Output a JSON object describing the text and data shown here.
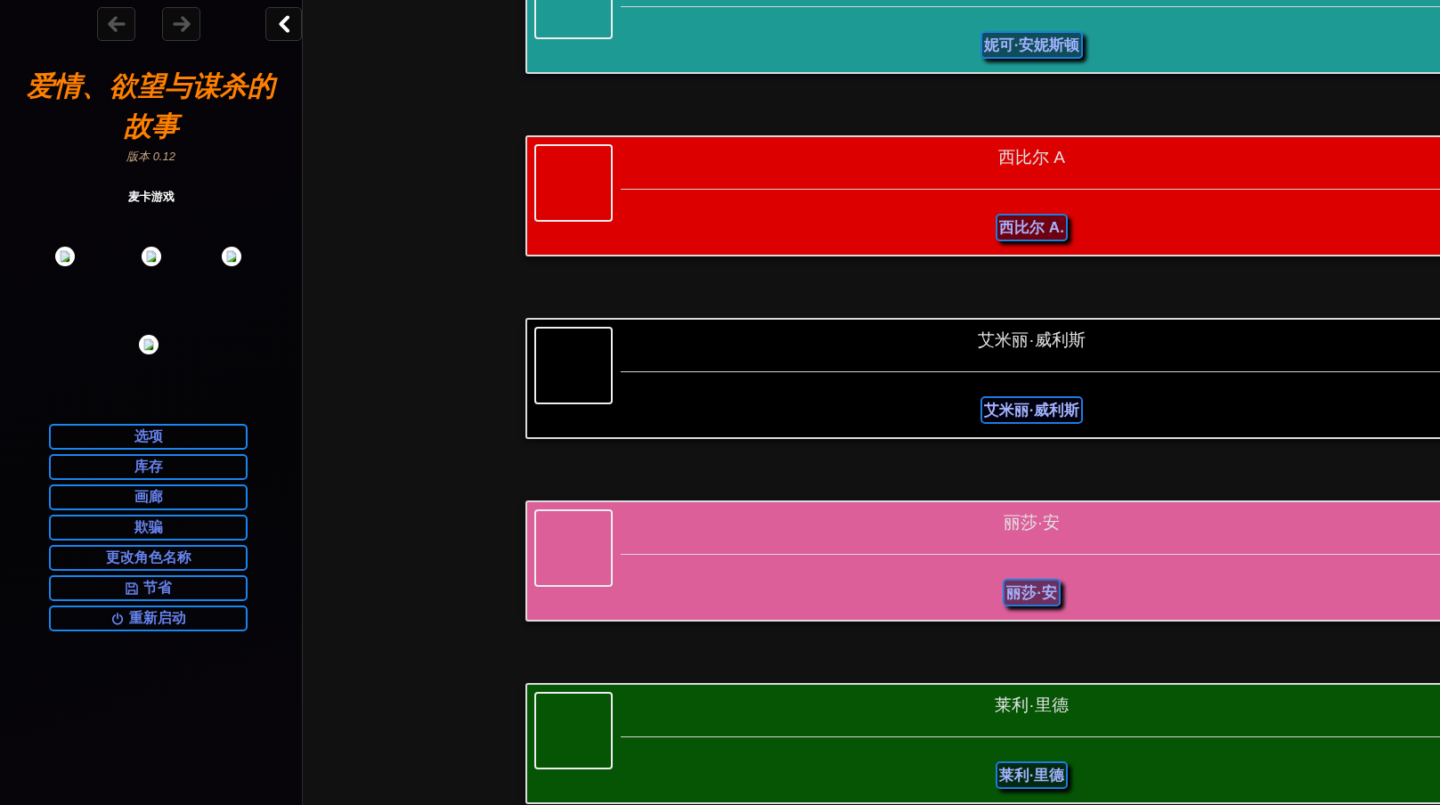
{
  "sidebar": {
    "history_buttons": [
      {
        "kind": "back",
        "disabled": true
      },
      {
        "kind": "forward",
        "disabled": true
      }
    ],
    "title": "爱情、欲望与谋杀的故事",
    "version": "版本 0.12",
    "studio": "麦卡游戏",
    "menu": [
      {
        "label": "选项",
        "kind": "plain"
      },
      {
        "label": "库存",
        "kind": "plain"
      },
      {
        "label": "画廊",
        "kind": "plain"
      },
      {
        "label": "欺骗",
        "kind": "plain"
      },
      {
        "label": "更改角色名称",
        "kind": "plain"
      },
      {
        "label": "节省",
        "kind": "save"
      },
      {
        "label": "重新启动",
        "kind": "power"
      }
    ]
  },
  "cards": [
    {
      "button": "妮可·安妮斯顿",
      "color": "#1e9a94"
    },
    {
      "name": "西比尔 A",
      "button": "西比尔 A.",
      "color": "#dc0000"
    },
    {
      "name": "艾米丽·威利斯",
      "button": "艾米丽·威利斯",
      "color": "#000000"
    },
    {
      "name": "丽莎·安",
      "button": "丽莎·安",
      "color": "#dc5f9a"
    },
    {
      "name": "莱利·里德",
      "button": "莱利·里德",
      "color": "#055505"
    }
  ]
}
